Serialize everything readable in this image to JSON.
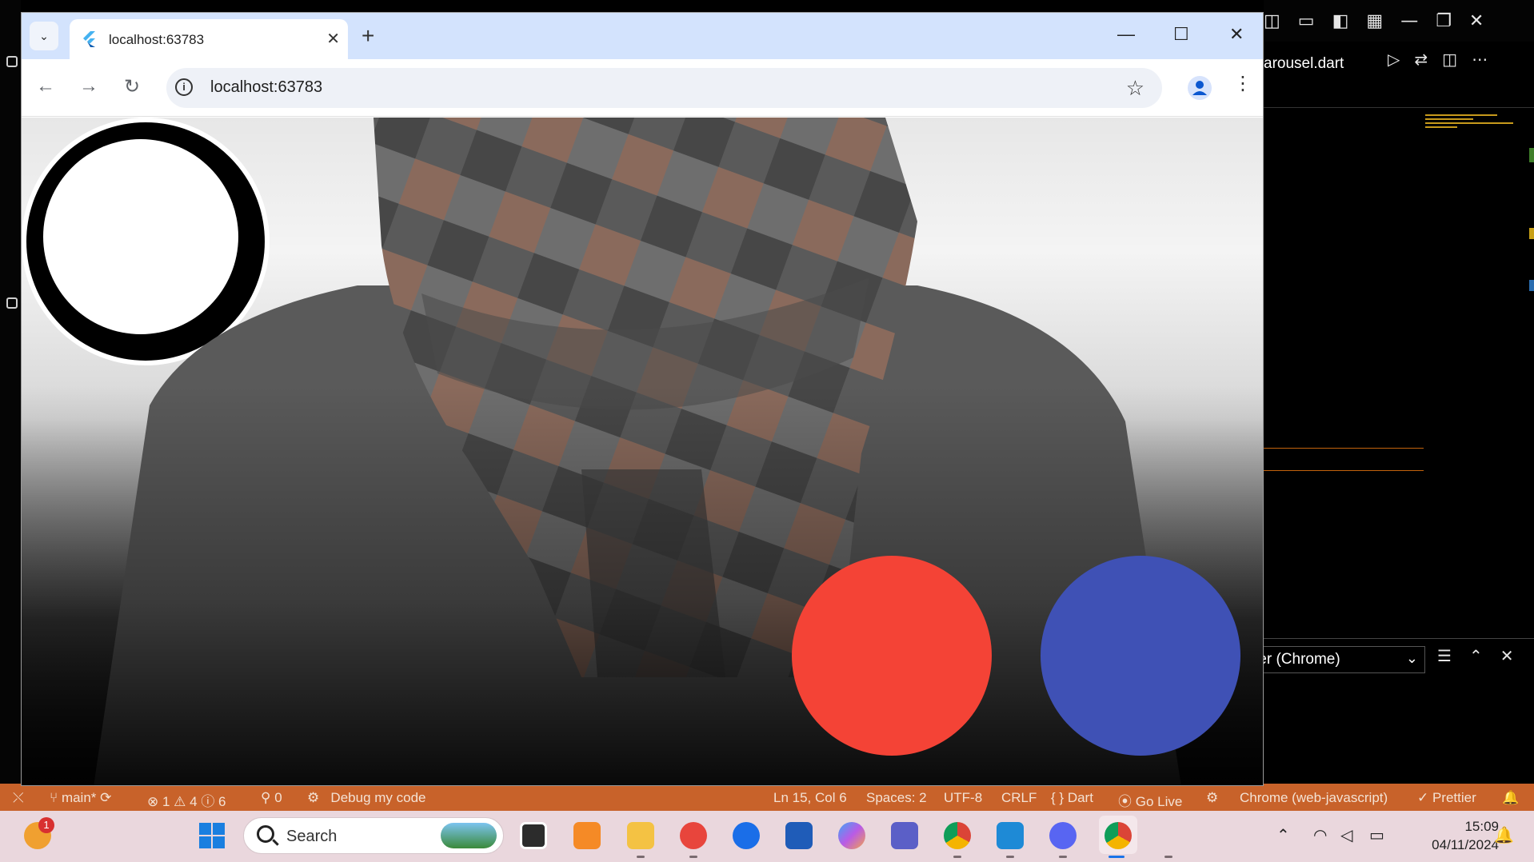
{
  "chrome": {
    "tab_title": "localhost:63783",
    "url": "localhost:63783",
    "new_tab_glyph": "+",
    "close_glyph": "✕"
  },
  "vscode": {
    "editor_tab": "arousel.dart",
    "terminal_select": "ter (Chrome)",
    "status": {
      "branch": "main*",
      "errors": "1",
      "warnings": "4",
      "infos": "6",
      "ports": "0",
      "debug": "Debug my code",
      "cursor": "Ln 15, Col 6",
      "spaces": "Spaces: 2",
      "encoding": "UTF-8",
      "eol": "CRLF",
      "language": "Dart",
      "golive": "Go Live",
      "device": "Chrome (web-javascript)",
      "prettier": "Prettier"
    }
  },
  "carousel": {
    "dots": [
      {
        "color": "#ffffff",
        "selected": true
      },
      {
        "color": "#f44336",
        "selected": false
      },
      {
        "color": "#3f51b5",
        "selected": false
      }
    ]
  },
  "taskbar": {
    "search_label": "Search",
    "time": "15:09",
    "date": "04/11/2024",
    "weather_badge": "1",
    "icons": [
      "windows-start-icon",
      "task-view-icon",
      "xampp-icon",
      "file-explorer-icon",
      "firefox-icon",
      "zoom-icon",
      "word-icon",
      "copilot-icon",
      "teams-icon",
      "chrome-profile-icon",
      "vscode-icon",
      "discord-icon",
      "chrome-icon"
    ]
  }
}
